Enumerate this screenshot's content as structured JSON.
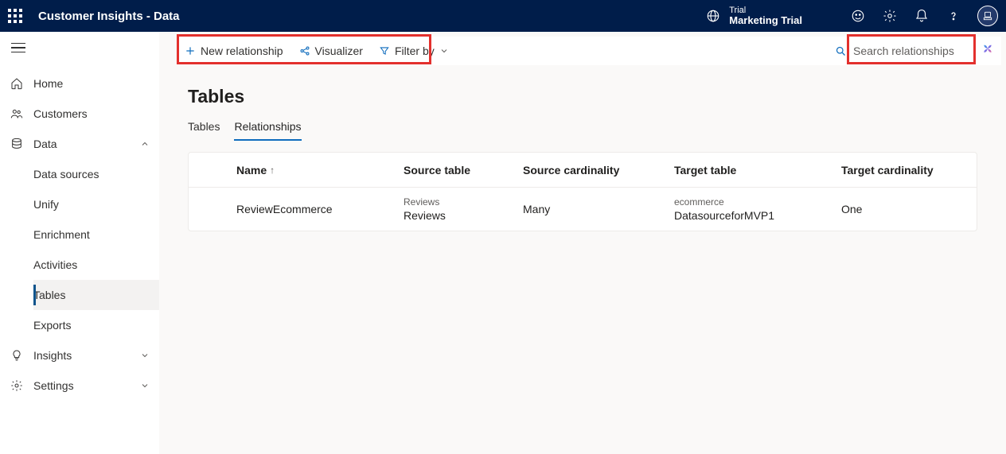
{
  "header": {
    "app_title": "Customer Insights - Data",
    "trial_label": "Trial",
    "trial_name": "Marketing Trial"
  },
  "sidebar": {
    "items": [
      {
        "label": "Home"
      },
      {
        "label": "Customers"
      },
      {
        "label": "Data",
        "expanded": true,
        "children": [
          {
            "label": "Data sources"
          },
          {
            "label": "Unify"
          },
          {
            "label": "Enrichment"
          },
          {
            "label": "Activities"
          },
          {
            "label": "Tables",
            "active": true
          },
          {
            "label": "Exports"
          }
        ]
      },
      {
        "label": "Insights"
      },
      {
        "label": "Settings"
      }
    ]
  },
  "toolbar": {
    "new_relationship": "New relationship",
    "visualizer": "Visualizer",
    "filter_by": "Filter by",
    "search_placeholder": "Search relationships"
  },
  "page": {
    "title": "Tables",
    "tabs": [
      {
        "label": "Tables"
      },
      {
        "label": "Relationships",
        "active": true
      }
    ],
    "columns": {
      "name": "Name",
      "source_table": "Source table",
      "source_cardinality": "Source cardinality",
      "target_table": "Target table",
      "target_cardinality": "Target cardinality"
    },
    "rows": [
      {
        "name": "ReviewEcommerce",
        "source_small": "Reviews",
        "source_main": "Reviews",
        "source_cardinality": "Many",
        "target_small": "ecommerce",
        "target_main": "DatasourceforMVP1",
        "target_cardinality": "One"
      }
    ]
  }
}
